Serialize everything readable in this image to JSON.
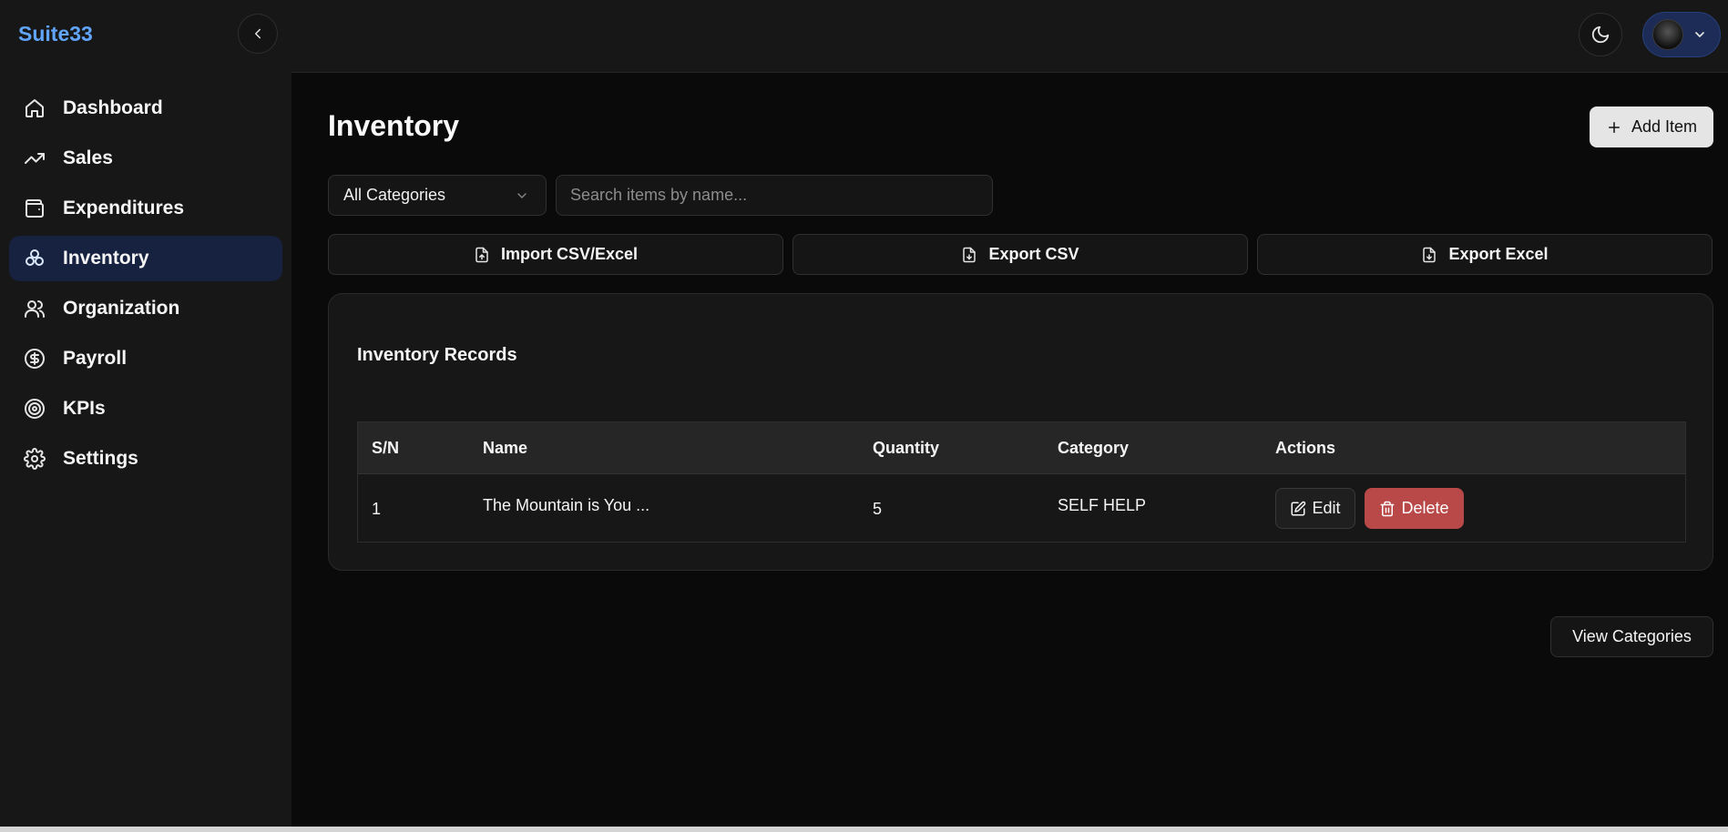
{
  "app": {
    "brand": "Suite33"
  },
  "sidebar": {
    "items": [
      {
        "label": "Dashboard",
        "icon": "home-icon",
        "active": false
      },
      {
        "label": "Sales",
        "icon": "trending-up-icon",
        "active": false
      },
      {
        "label": "Expenditures",
        "icon": "wallet-icon",
        "active": false
      },
      {
        "label": "Inventory",
        "icon": "boxes-icon",
        "active": true
      },
      {
        "label": "Organization",
        "icon": "users-icon",
        "active": false
      },
      {
        "label": "Payroll",
        "icon": "dollar-circle-icon",
        "active": false
      },
      {
        "label": "KPIs",
        "icon": "target-icon",
        "active": false
      },
      {
        "label": "Settings",
        "icon": "gear-icon",
        "active": false
      }
    ]
  },
  "header": {
    "theme_icon": "moon-icon"
  },
  "page": {
    "title": "Inventory",
    "add_button": "Add Item",
    "category_select": "All Categories",
    "search_placeholder": "Search items by name...",
    "search_value": "",
    "import_button": "Import CSV/Excel",
    "export_csv_button": "Export CSV",
    "export_excel_button": "Export Excel",
    "view_categories_button": "View Categories"
  },
  "records": {
    "title": "Inventory Records",
    "columns": [
      "S/N",
      "Name",
      "Quantity",
      "Category",
      "Actions"
    ],
    "rows": [
      {
        "sn": "1",
        "name": "The Mountain is You ...",
        "quantity": "5",
        "category": "SELF HELP",
        "edit": "Edit",
        "delete": "Delete"
      }
    ]
  },
  "colors": {
    "brand": "#60a5fa",
    "active_nav": "#172241",
    "delete": "#b94848",
    "primary_button": "#e5e5e5"
  }
}
